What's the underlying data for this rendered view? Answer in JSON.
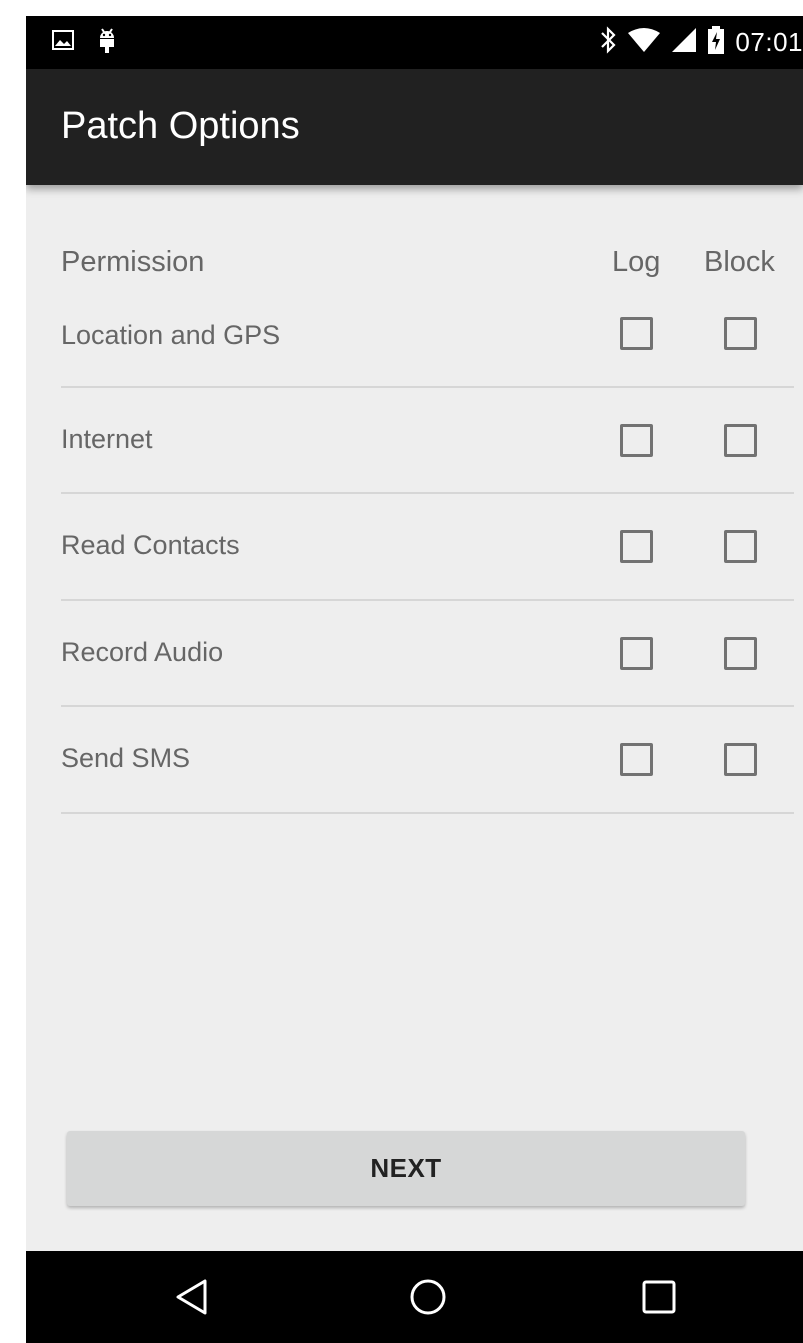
{
  "status_bar": {
    "time": "07:01",
    "left_icons": [
      "image-icon",
      "android-icon"
    ],
    "right_icons": [
      "bluetooth-icon",
      "wifi-icon",
      "signal-icon",
      "battery-charging-icon"
    ]
  },
  "app_bar": {
    "title": "Patch Options"
  },
  "table": {
    "headers": {
      "permission": "Permission",
      "log": "Log",
      "block": "Block"
    },
    "rows": [
      {
        "label": "Location and GPS",
        "log": false,
        "block": false
      },
      {
        "label": "Internet",
        "log": false,
        "block": false
      },
      {
        "label": "Read Contacts",
        "log": false,
        "block": false
      },
      {
        "label": "Record Audio",
        "log": false,
        "block": false
      },
      {
        "label": "Send SMS",
        "log": false,
        "block": false
      }
    ]
  },
  "next_button": {
    "label": "NEXT"
  },
  "nav_bar": {
    "icons": [
      "back-icon",
      "home-icon",
      "recents-icon"
    ]
  },
  "colors": {
    "status_bar": "#000000",
    "app_bar": "#212121",
    "background": "#eeeeee",
    "text_secondary": "#666666",
    "checkbox": "#727272",
    "button": "#d6d7d7"
  }
}
